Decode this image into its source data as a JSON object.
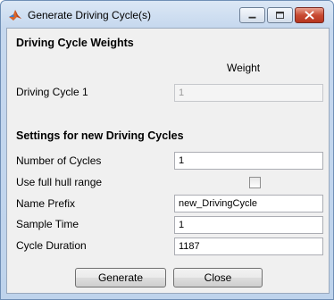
{
  "window": {
    "title": "Generate Driving Cycle(s)",
    "icon": "matlab-logo-icon",
    "controls": [
      "minimize-icon",
      "maximize-icon",
      "close-icon"
    ]
  },
  "weights_section": {
    "title": "Driving Cycle Weights",
    "column_header": "Weight",
    "rows": [
      {
        "label": "Driving Cycle 1",
        "value": "1",
        "enabled": false
      }
    ]
  },
  "settings_section": {
    "title": "Settings for new Driving Cycles",
    "number_of_cycles": {
      "label": "Number of Cycles",
      "value": "1"
    },
    "use_full_hull_range": {
      "label": "Use full hull range",
      "checked": false
    },
    "name_prefix": {
      "label": "Name Prefix",
      "value": "new_DrivingCycle"
    },
    "sample_time": {
      "label": "Sample Time",
      "value": "1"
    },
    "cycle_duration": {
      "label": "Cycle Duration",
      "value": "1187"
    }
  },
  "buttons": {
    "generate": "Generate",
    "close": "Close"
  }
}
